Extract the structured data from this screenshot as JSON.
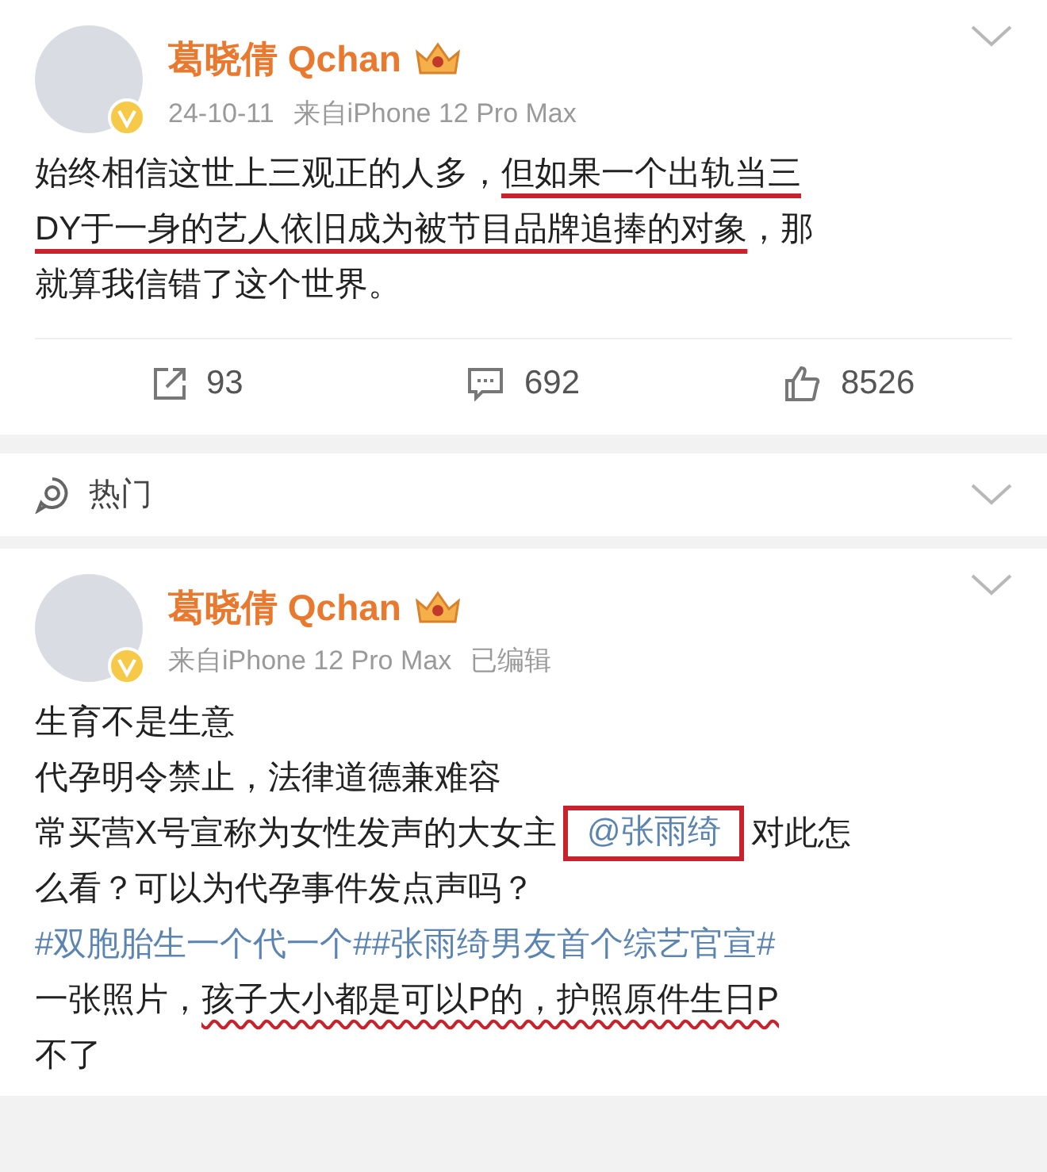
{
  "posts": [
    {
      "author": "葛晓倩 Qchan",
      "meta": [
        "24-10-11",
        "来自iPhone 12 Pro Max"
      ],
      "lines": [
        [
          {
            "text": "始终相信这世上三观正的人多，",
            "kind": "text"
          },
          {
            "text": "但如果一个出轨当三",
            "kind": "underlined"
          }
        ],
        [
          {
            "text": "DY于一身的艺人依旧成为被节目品牌追捧的对象",
            "kind": "underlined"
          },
          {
            "text": "，那",
            "kind": "text"
          }
        ],
        [
          {
            "text": "就算我信错了这个世界。",
            "kind": "text"
          }
        ]
      ],
      "stats": [
        {
          "kind": "repost",
          "count": "93"
        },
        {
          "kind": "comment",
          "count": "692"
        },
        {
          "kind": "like",
          "count": "8526"
        }
      ]
    },
    {
      "section": "热门",
      "author": "葛晓倩 Qchan",
      "meta": [
        "来自iPhone 12 Pro Max",
        "已编辑"
      ],
      "lines": [
        [
          {
            "text": "生育不是生意",
            "kind": "text"
          }
        ],
        [
          {
            "text": "代孕明令禁止，法律道德兼难容",
            "kind": "text"
          }
        ],
        [
          {
            "text": "常买营X号宣称为女性发声的大女主",
            "kind": "text"
          },
          {
            "text": "@张雨绮",
            "kind": "boxed"
          },
          {
            "text": "对此怎",
            "kind": "text"
          }
        ],
        [
          {
            "text": "么看？可以为代孕事件发点声吗？",
            "kind": "text"
          }
        ],
        [
          {
            "text": "#双胞胎生一个代一个##张雨绮男友首个综艺官宣#",
            "kind": "hashtag"
          }
        ],
        [
          {
            "text": "一张照片，",
            "kind": "text"
          },
          {
            "text": "孩子大小都是可以P的，护照原件生日P",
            "kind": "wavy"
          }
        ],
        [
          {
            "text": "不了",
            "kind": "text"
          }
        ]
      ]
    }
  ]
}
